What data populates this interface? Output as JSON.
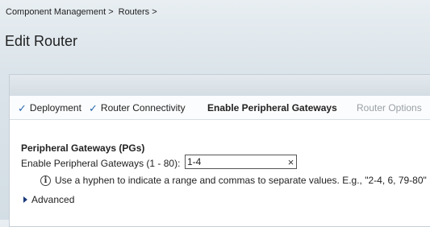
{
  "breadcrumb": {
    "items": [
      "Component Management >",
      "Routers >"
    ]
  },
  "page": {
    "title": "Edit Router"
  },
  "steps": [
    {
      "label": "Deployment",
      "state": "done"
    },
    {
      "label": "Router Connectivity",
      "state": "done"
    },
    {
      "label": "Enable Peripheral Gateways",
      "state": "current"
    },
    {
      "label": "Router Options",
      "state": "disabled"
    }
  ],
  "form": {
    "section_title": "Peripheral Gateways (PGs)",
    "field_label": "Enable Peripheral Gateways (1 - 80):",
    "field_value": "1-4",
    "clear_icon": "×",
    "hint": "Use a hyphen to indicate a range and commas to separate values. E.g., \"2-4, 6, 79-80\"",
    "info_icon": "i",
    "advanced_label": "Advanced"
  },
  "icons": {
    "check": "✓"
  },
  "colors": {
    "accent": "#2a6bb0",
    "disabled_text": "#9aa0a5"
  }
}
